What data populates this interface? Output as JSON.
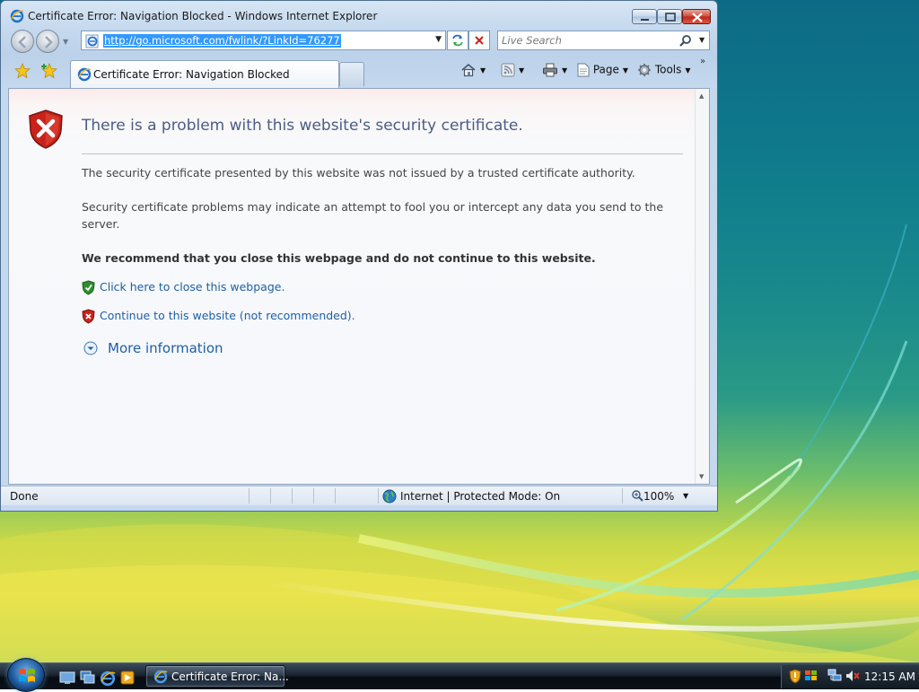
{
  "window": {
    "title": "Certificate Error: Navigation Blocked - Windows Internet Explorer"
  },
  "address_bar": {
    "url": "http://go.microsoft.com/fwlink/?LinkId=76277"
  },
  "search": {
    "placeholder": "Live Search"
  },
  "tab": {
    "label": "Certificate Error: Navigation Blocked"
  },
  "command_bar": {
    "page_label": "Page",
    "tools_label": "Tools",
    "more_label": "»"
  },
  "content": {
    "heading": "There is a problem with this website's security certificate.",
    "paragraph_1": "The security certificate presented by this website was not issued by a trusted certificate authority.",
    "paragraph_2": "Security certificate problems may indicate an attempt to fool you or intercept any data you send to the server.",
    "recommendation": "We recommend that you close this webpage and do not continue to this website.",
    "close_link": "Click here to close this webpage.",
    "continue_link": "Continue to this website (not recommended).",
    "more_info": "More information"
  },
  "status_bar": {
    "status": "Done",
    "zone": "Internet | Protected Mode: On",
    "zoom": "100%"
  },
  "taskbar": {
    "task_label": "Certificate Error: Na...",
    "clock": "12:15 AM"
  },
  "icons": {
    "title": "ie-logo-icon",
    "back": "back-arrow-icon",
    "forward": "forward-arrow-icon",
    "refresh": "refresh-icon",
    "stop": "stop-icon",
    "search": "magnifier-icon",
    "favorites": "star-icon",
    "add_favorite": "add-star-icon",
    "home": "home-icon",
    "feeds": "rss-icon",
    "print": "printer-icon",
    "page": "page-icon",
    "tools": "gear-icon",
    "error": "red-shield-x-icon",
    "close_link": "green-shield-check-icon",
    "continue_link": "red-shield-x-icon",
    "more_info": "expand-circle-icon",
    "zone": "globe-icon",
    "zoom": "zoom-icon"
  },
  "colors": {
    "link": "#1d5fa6",
    "heading": "#4a5d86",
    "error_red": "#c8231b",
    "safe_green": "#2e8f2a",
    "url_highlight": "#3399ff"
  }
}
